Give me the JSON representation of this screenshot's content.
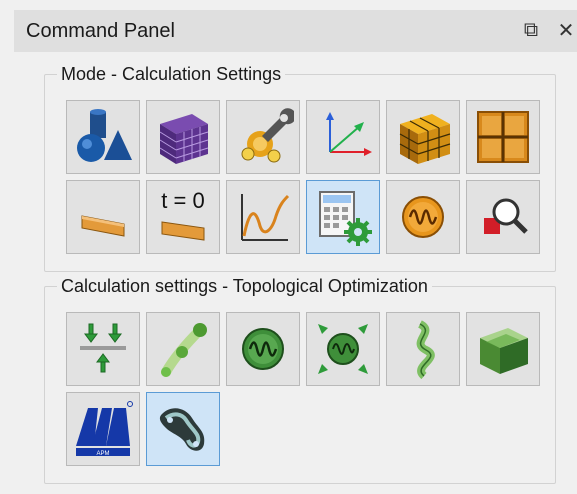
{
  "panel": {
    "title": "Command Panel",
    "float_icon": "⧉",
    "close_icon": "✕"
  },
  "groups": [
    {
      "legend": "Mode - Calculation Settings",
      "tools": [
        {
          "icon": "geometry-shapes-icon"
        },
        {
          "icon": "mesh-cube-icon"
        },
        {
          "icon": "properties-wrench-icon"
        },
        {
          "icon": "coordinate-axes-icon"
        },
        {
          "icon": "orange-mesh-cube-icon"
        },
        {
          "icon": "grid-panel-icon"
        },
        {
          "icon": "beam-element-icon"
        },
        {
          "icon": "initial-time-icon",
          "label": "t = 0"
        },
        {
          "icon": "curve-plot-icon"
        },
        {
          "icon": "calculation-settings-icon",
          "active": true
        },
        {
          "icon": "oscillation-icon"
        },
        {
          "icon": "inspect-zoom-icon"
        }
      ]
    },
    {
      "legend": "Calculation settings - Topological Optimization",
      "tools": [
        {
          "icon": "load-arrows-icon"
        },
        {
          "icon": "path-nodes-icon"
        },
        {
          "icon": "frequency-icon"
        },
        {
          "icon": "frequency-constraint-icon"
        },
        {
          "icon": "twisted-strip-icon"
        },
        {
          "icon": "green-cube-icon"
        },
        {
          "icon": "apm-logo-icon"
        },
        {
          "icon": "topology-bracket-icon",
          "active": true
        }
      ]
    }
  ]
}
